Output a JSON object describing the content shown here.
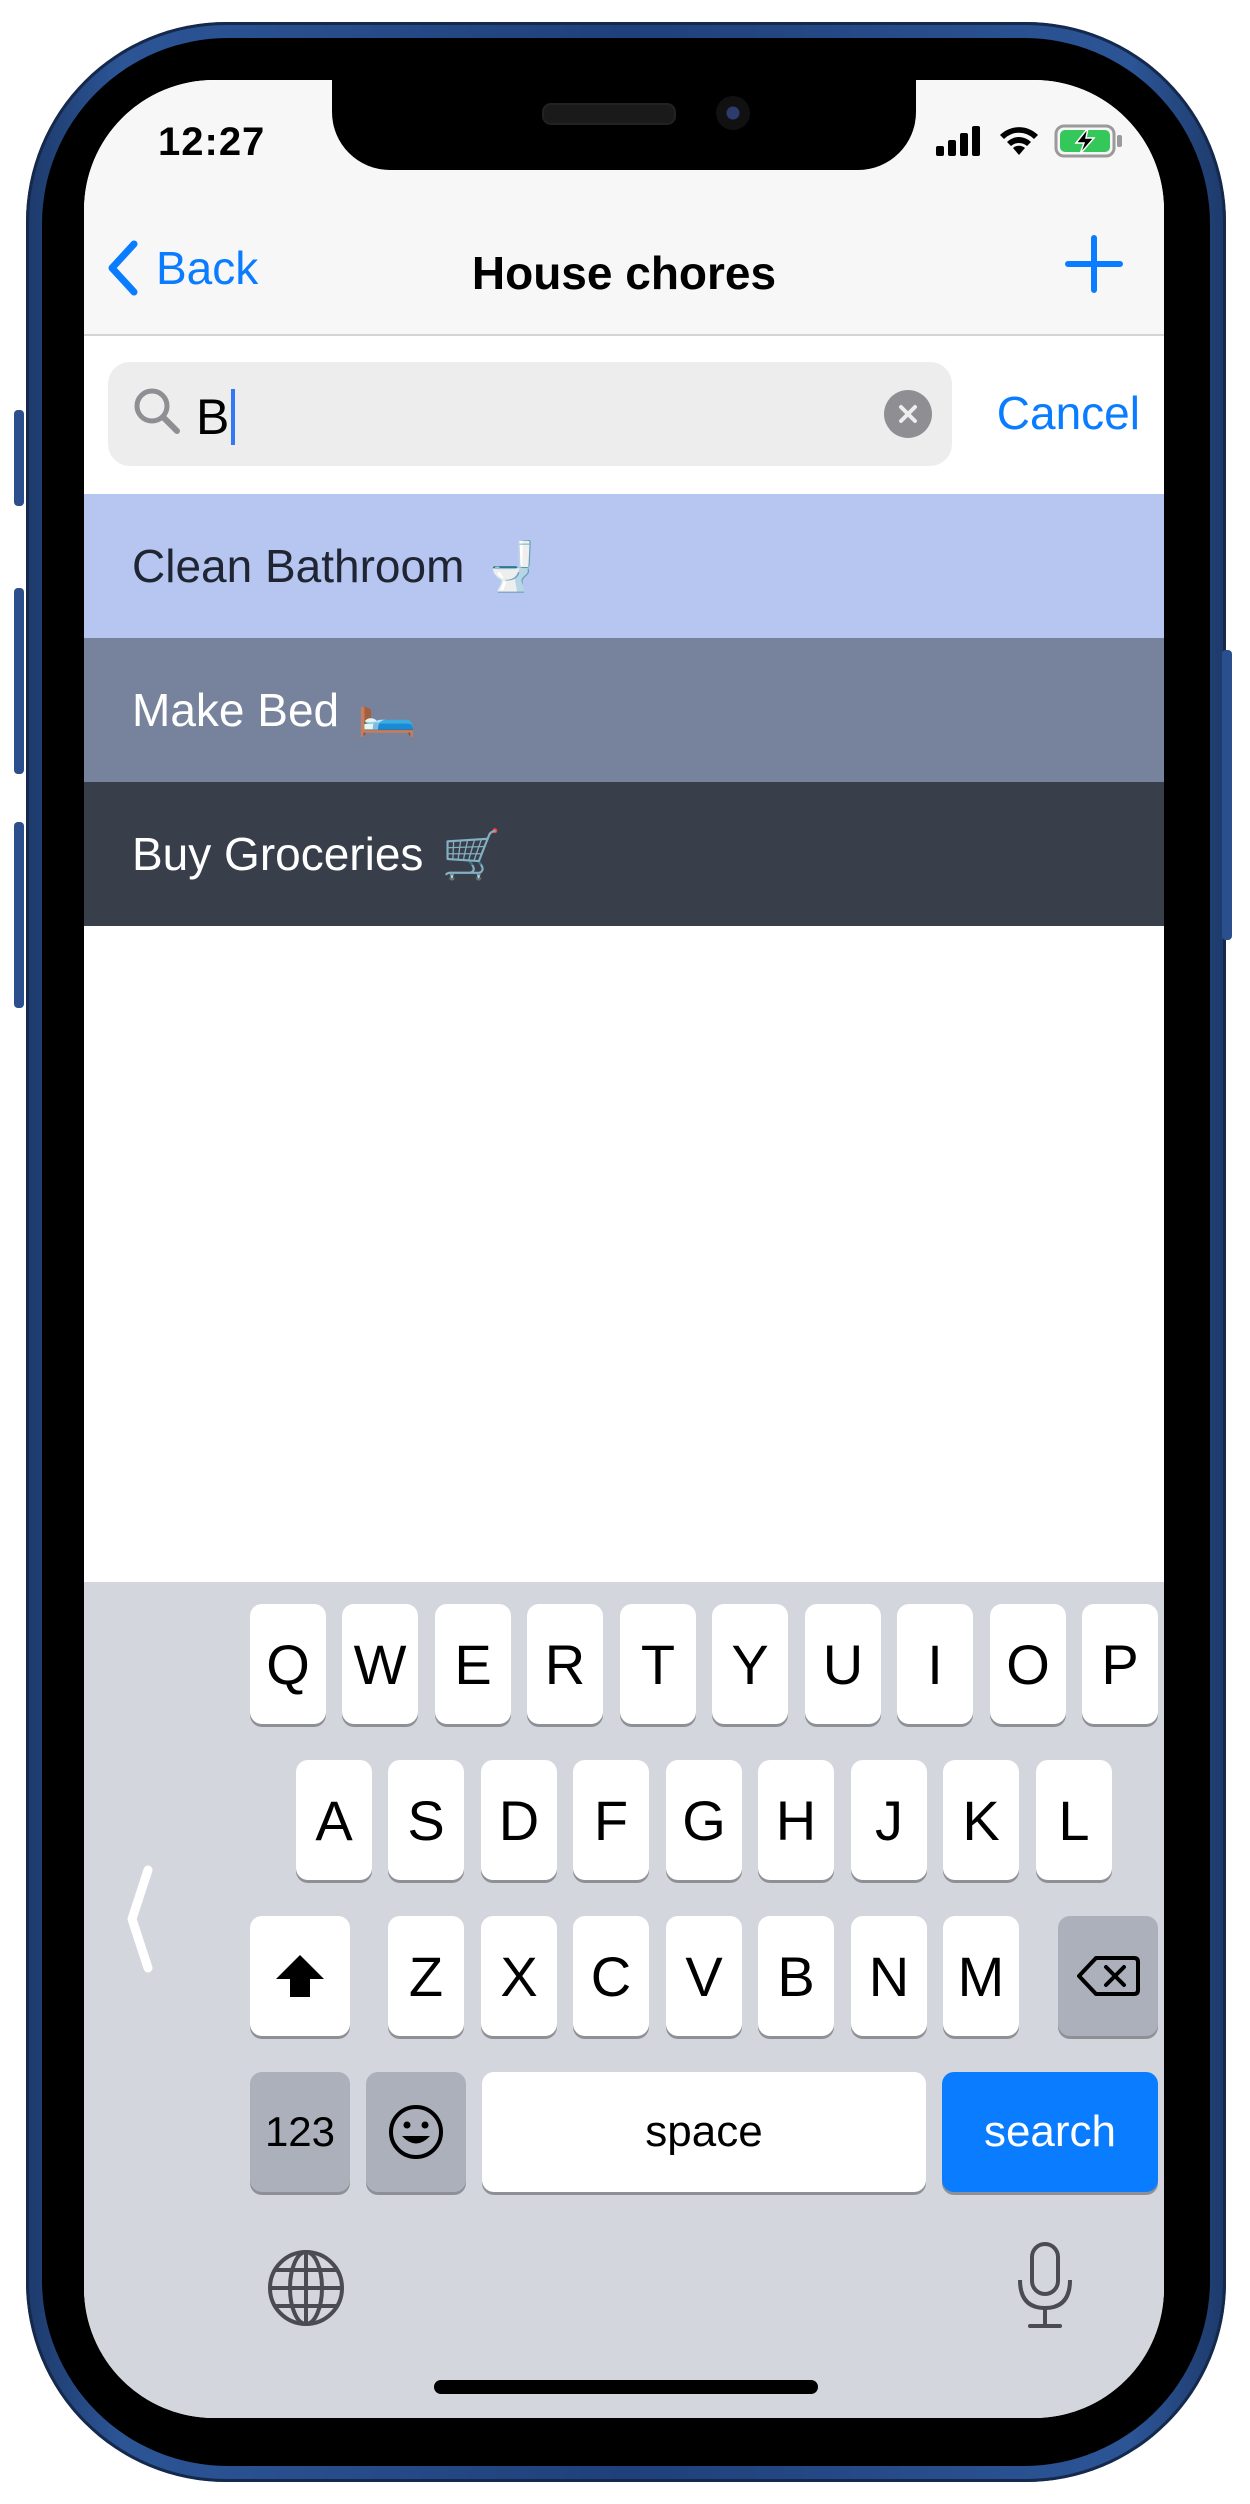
{
  "status_bar": {
    "time": "12:27",
    "icons": [
      "signal-bars-icon",
      "wifi-icon",
      "battery-charging-icon"
    ]
  },
  "navbar": {
    "back_label": "Back",
    "title": "House chores",
    "add_icon": "plus-icon"
  },
  "search": {
    "value": "B",
    "placeholder": "",
    "cancel_label": "Cancel"
  },
  "results": [
    {
      "label": "Clean Bathroom",
      "emoji": "🚽",
      "color": "#b6c6f0"
    },
    {
      "label": "Make Bed",
      "emoji": "🛏️",
      "color": "#77839d"
    },
    {
      "label": "Buy Groceries",
      "emoji": "🛒",
      "color": "#393e4b"
    }
  ],
  "keyboard": {
    "row1": [
      "Q",
      "W",
      "E",
      "R",
      "T",
      "Y",
      "U",
      "I",
      "O",
      "P"
    ],
    "row2": [
      "A",
      "S",
      "D",
      "F",
      "G",
      "H",
      "J",
      "K",
      "L"
    ],
    "row3": [
      "Z",
      "X",
      "C",
      "V",
      "B",
      "N",
      "M"
    ],
    "numbers_label": "123",
    "space_label": "space",
    "search_label": "search",
    "accent_color": "#0a7cff"
  }
}
